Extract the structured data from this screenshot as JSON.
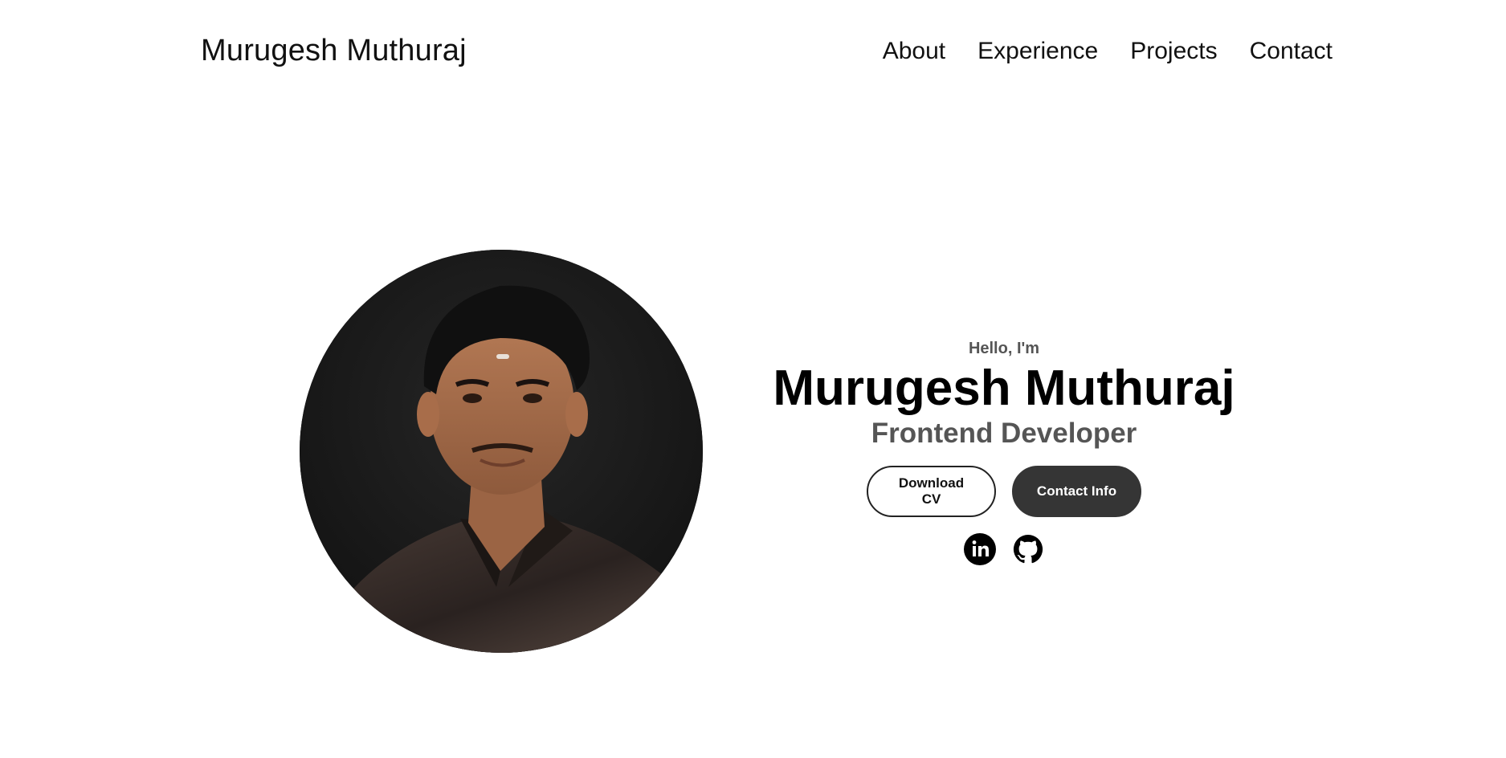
{
  "header": {
    "logo": "Murugesh Muthuraj",
    "nav": [
      {
        "label": "About"
      },
      {
        "label": "Experience"
      },
      {
        "label": "Projects"
      },
      {
        "label": "Contact"
      }
    ]
  },
  "hero": {
    "greeting": "Hello, I'm",
    "name": "Murugesh Muthuraj",
    "role": "Frontend Developer",
    "buttons": {
      "download": "Download CV",
      "contact": "Contact Info"
    },
    "socials": [
      {
        "icon": "linkedin-icon"
      },
      {
        "icon": "github-icon"
      }
    ],
    "colors": {
      "solid_button": "#353535",
      "muted_text": "#555555"
    }
  }
}
